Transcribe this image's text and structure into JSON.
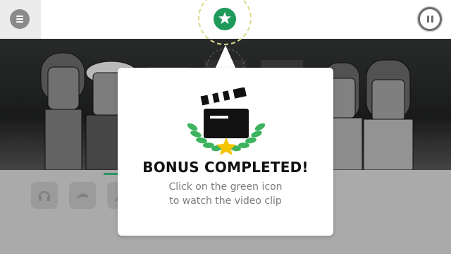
{
  "topbar": {
    "menu_icon": "hamburger-icon",
    "center_icon": "star-icon",
    "pause_icon": "pause-icon",
    "accent_color": "#1f9a5b"
  },
  "toolbar": {
    "tools": [
      "headphones-icon",
      "cap-icon",
      "microphone-icon"
    ]
  },
  "modal": {
    "icon": "clapperboard-icon",
    "decoration": "laurel-wreath-with-star",
    "title": "BONUS COMPLETED!",
    "message_line1": "Click on the green icon",
    "message_line2": "to watch the video clip"
  }
}
